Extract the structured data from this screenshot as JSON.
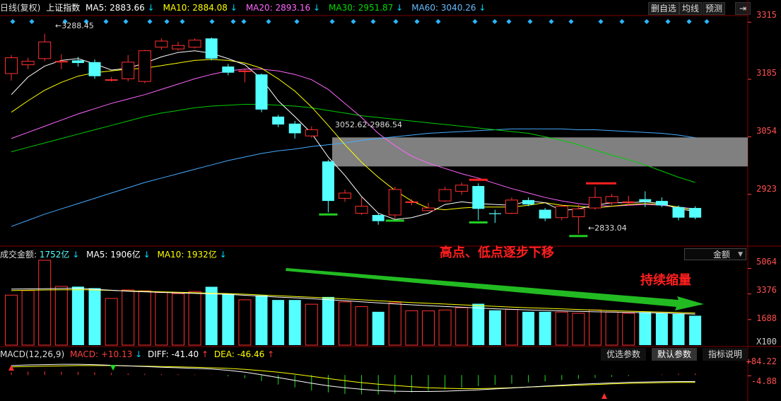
{
  "header": {
    "label": "日线(复权)",
    "name": "上证指数",
    "ma": [
      {
        "label": "MA5:",
        "value": "2883.66",
        "color": "#ffffff"
      },
      {
        "label": "MA10:",
        "value": "2884.08",
        "color": "#ffff00"
      },
      {
        "label": "MA20:",
        "value": "2893.16",
        "color": "#ff66ff"
      },
      {
        "label": "MA30:",
        "value": "2951.87",
        "color": "#00dd00"
      },
      {
        "label": "MA60:",
        "value": "3040.26",
        "color": "#66bbff"
      }
    ],
    "arrow": "↓",
    "buttons": [
      "删自选",
      "均线",
      "预测"
    ],
    "menu_icon": "exit-icon"
  },
  "price_axis": [
    "3315",
    "3185",
    "3054",
    "2923"
  ],
  "volume_header": {
    "label": "成交金额:",
    "value": "1752亿",
    "ma5_label": "MA5:",
    "ma5_value": "1906亿",
    "ma10_label": "MA10:",
    "ma10_value": "1932亿",
    "arrow": "↓",
    "select_value": "金额"
  },
  "volume_axis": [
    "5064",
    "3376",
    "1688",
    "X100"
  ],
  "macd_header": {
    "label": "MACD(12,26,9)",
    "macd_label": "MACD:",
    "macd_value": "+10.13",
    "macd_arrow": "↓",
    "diff_label": "DIFF:",
    "diff_value": "-41.40",
    "diff_arrow": "↑",
    "dea_label": "DEA:",
    "dea_value": "-46.46",
    "dea_arrow": "↑",
    "tabs": [
      "优选参数",
      "默认参数",
      "指标说明"
    ]
  },
  "macd_axis": [
    "+84.22",
    "-4.88"
  ],
  "annotations": {
    "high_label": "3288.45",
    "low_label": "2833.04",
    "box_label": "3052.62-2986.54",
    "text1": "高点、低点逐步下移",
    "text2": "持续缩量"
  },
  "colors": {
    "up": "#ff3030",
    "down": "#54ffff",
    "ma5": "#ffffff",
    "ma10": "#ffff00",
    "ma20": "#ff66ff",
    "ma30": "#00cc00",
    "ma60": "#44aaff",
    "grid": "#800000"
  },
  "chart_data": {
    "type": "candlestick",
    "price_ylim": [
      2810,
      3330
    ],
    "candles": [
      {
        "o": 3198,
        "c": 3234,
        "h": 3240,
        "l": 3182
      },
      {
        "o": 3218,
        "c": 3226,
        "h": 3234,
        "l": 3208
      },
      {
        "o": 3232,
        "c": 3270,
        "h": 3288.45,
        "l": 3226
      },
      {
        "o": 3224,
        "c": 3226,
        "h": 3242,
        "l": 3208
      },
      {
        "o": 3228,
        "c": 3222,
        "h": 3236,
        "l": 3214
      },
      {
        "o": 3224,
        "c": 3192,
        "h": 3230,
        "l": 3186
      },
      {
        "o": 3184,
        "c": 3184,
        "h": 3190,
        "l": 3180
      },
      {
        "o": 3186,
        "c": 3224,
        "h": 3240,
        "l": 3180
      },
      {
        "o": 3180,
        "c": 3250,
        "h": 3252,
        "l": 3176
      },
      {
        "o": 3258,
        "c": 3272,
        "h": 3278,
        "l": 3252
      },
      {
        "o": 3254,
        "c": 3262,
        "h": 3270,
        "l": 3250
      },
      {
        "o": 3258,
        "c": 3274,
        "h": 3278,
        "l": 3255
      },
      {
        "o": 3278,
        "c": 3232,
        "h": 3280,
        "l": 3228
      },
      {
        "o": 3214,
        "c": 3200,
        "h": 3220,
        "l": 3194
      },
      {
        "o": 3204,
        "c": 3204,
        "h": 3210,
        "l": 3178
      },
      {
        "o": 3196,
        "c": 3116,
        "h": 3198,
        "l": 3110
      },
      {
        "o": 3100,
        "c": 3082,
        "h": 3104,
        "l": 3076
      },
      {
        "o": 3084,
        "c": 3062,
        "h": 3090,
        "l": 3050
      },
      {
        "o": 3056,
        "c": 3070,
        "h": 3078,
        "l": 3052
      },
      {
        "o": 2998,
        "c": 2908,
        "h": 3002,
        "l": 2882
      },
      {
        "o": 2914,
        "c": 2926,
        "h": 2934,
        "l": 2906
      },
      {
        "o": 2880,
        "c": 2896,
        "h": 2916,
        "l": 2876
      },
      {
        "o": 2876,
        "c": 2862,
        "h": 2880,
        "l": 2854
      },
      {
        "o": 2876,
        "c": 2934,
        "h": 2940,
        "l": 2868
      },
      {
        "o": 2906,
        "c": 2906,
        "h": 2912,
        "l": 2898
      },
      {
        "o": 2886,
        "c": 2892,
        "h": 2904,
        "l": 2884
      },
      {
        "o": 2908,
        "c": 2934,
        "h": 2940,
        "l": 2906
      },
      {
        "o": 2930,
        "c": 2944,
        "h": 2950,
        "l": 2922
      },
      {
        "o": 2942,
        "c": 2890,
        "h": 2948,
        "l": 2864
      },
      {
        "o": 2880,
        "c": 2878,
        "h": 2888,
        "l": 2858
      },
      {
        "o": 2880,
        "c": 2910,
        "h": 2916,
        "l": 2878
      },
      {
        "o": 2910,
        "c": 2900,
        "h": 2916,
        "l": 2896
      },
      {
        "o": 2888,
        "c": 2868,
        "h": 2892,
        "l": 2862
      },
      {
        "o": 2870,
        "c": 2896,
        "h": 2900,
        "l": 2864
      },
      {
        "o": 2872,
        "c": 2890,
        "h": 2900,
        "l": 2833.04
      },
      {
        "o": 2892,
        "c": 2916,
        "h": 2940,
        "l": 2888
      },
      {
        "o": 2904,
        "c": 2918,
        "h": 2924,
        "l": 2898
      },
      {
        "o": 2906,
        "c": 2906,
        "h": 2920,
        "l": 2898
      },
      {
        "o": 2912,
        "c": 2906,
        "h": 2930,
        "l": 2894
      },
      {
        "o": 2908,
        "c": 2898,
        "h": 2916,
        "l": 2894
      },
      {
        "o": 2894,
        "c": 2870,
        "h": 2898,
        "l": 2864
      },
      {
        "o": 2892,
        "c": 2870,
        "h": 2896,
        "l": 2866
      }
    ],
    "ma5": [
      3150,
      3190,
      3215,
      3228,
      3232,
      3220,
      3206,
      3210,
      3222,
      3236,
      3246,
      3250,
      3244,
      3232,
      3218,
      3186,
      3136,
      3100,
      3062,
      3008,
      2966,
      2918,
      2880,
      2866,
      2870,
      2880,
      2900,
      2906,
      2902,
      2900,
      2898,
      2908,
      2904,
      2886,
      2890,
      2898,
      2904,
      2904,
      2906,
      2902,
      2890,
      2884
    ],
    "ma10": [
      3110,
      3136,
      3160,
      3178,
      3192,
      3200,
      3204,
      3208,
      3210,
      3216,
      3222,
      3228,
      3230,
      3228,
      3222,
      3210,
      3186,
      3158,
      3122,
      3080,
      3036,
      2996,
      2962,
      2932,
      2908,
      2892,
      2888,
      2892,
      2894,
      2894,
      2894,
      2898,
      2904,
      2898,
      2896,
      2892,
      2896,
      2900,
      2902,
      2900,
      2894,
      2886
    ],
    "ma20": [
      3050,
      3064,
      3078,
      3092,
      3106,
      3118,
      3130,
      3140,
      3150,
      3162,
      3174,
      3186,
      3196,
      3204,
      3208,
      3208,
      3204,
      3196,
      3184,
      3162,
      3130,
      3098,
      3062,
      3034,
      3010,
      2994,
      2982,
      2970,
      2960,
      2948,
      2936,
      2926,
      2916,
      2908,
      2902,
      2898,
      2896,
      2898,
      2900,
      2898,
      2894,
      2890
    ],
    "ma30": [
      3020,
      3030,
      3040,
      3050,
      3060,
      3070,
      3080,
      3090,
      3100,
      3108,
      3114,
      3120,
      3124,
      3126,
      3128,
      3128,
      3126,
      3124,
      3120,
      3114,
      3108,
      3102,
      3098,
      3094,
      3090,
      3086,
      3082,
      3078,
      3074,
      3070,
      3066,
      3062,
      3054,
      3046,
      3036,
      3024,
      3012,
      3002,
      2990,
      2976,
      2962,
      2950
    ],
    "ma60": [
      2850,
      2864,
      2878,
      2890,
      2902,
      2914,
      2926,
      2938,
      2950,
      2960,
      2970,
      2980,
      2990,
      3000,
      3008,
      3016,
      3022,
      3026,
      3032,
      3036,
      3040,
      3046,
      3050,
      3054,
      3058,
      3062,
      3064,
      3066,
      3068,
      3070,
      3072,
      3072,
      3072,
      3072,
      3070,
      3070,
      3068,
      3066,
      3064,
      3062,
      3058,
      3052
    ],
    "box_range": [
      2986.54,
      3052.62
    ],
    "volume_ylim": [
      0,
      5600
    ],
    "volume": [
      3300,
      3600,
      5600,
      3880,
      3860,
      3760,
      3080,
      3640,
      3580,
      3470,
      3400,
      3540,
      3850,
      3400,
      2990,
      3280,
      2980,
      2980,
      2700,
      3180,
      2850,
      2540,
      2200,
      2800,
      2270,
      2260,
      2320,
      2470,
      2730,
      2300,
      2350,
      2200,
      2200,
      2180,
      2100,
      2320,
      2180,
      2100,
      2180,
      2120,
      2060,
      1940
    ],
    "volume_ma5": [
      3700,
      3710,
      3720,
      3740,
      3760,
      3680,
      3620,
      3560,
      3520,
      3480,
      3440,
      3410,
      3380,
      3350,
      3290,
      3230,
      3170,
      3120,
      3060,
      3000,
      2930,
      2860,
      2790,
      2720,
      2660,
      2600,
      2550,
      2500,
      2450,
      2400,
      2360,
      2320,
      2290,
      2260,
      2230,
      2200,
      2180,
      2160,
      2140,
      2120,
      2080,
      2040
    ],
    "volume_ma10": [
      3600,
      3620,
      3640,
      3650,
      3660,
      3640,
      3610,
      3580,
      3550,
      3520,
      3490,
      3460,
      3430,
      3400,
      3360,
      3310,
      3260,
      3210,
      3160,
      3110,
      3050,
      2990,
      2930,
      2870,
      2810,
      2760,
      2710,
      2660,
      2610,
      2560,
      2510,
      2470,
      2430,
      2390,
      2350,
      2310,
      2270,
      2240,
      2210,
      2180,
      2150,
      2120
    ],
    "macd_ylim": [
      -160,
      100
    ],
    "macd": [
      18,
      22,
      24,
      22,
      20,
      18,
      14,
      10,
      8,
      6,
      6,
      4,
      2,
      -8,
      -20,
      -38,
      -60,
      -78,
      -98,
      -110,
      -120,
      -122,
      -124,
      -118,
      -110,
      -100,
      -90,
      -80,
      -70,
      -62,
      -54,
      -46,
      -40,
      -32,
      -24,
      -18,
      -12,
      -6,
      0,
      4,
      8,
      10.13
    ],
    "diff": [
      60,
      64,
      66,
      68,
      68,
      66,
      62,
      58,
      54,
      50,
      46,
      42,
      38,
      30,
      18,
      2,
      -16,
      -34,
      -52,
      -68,
      -80,
      -90,
      -98,
      -102,
      -104,
      -104,
      -102,
      -98,
      -94,
      -88,
      -82,
      -76,
      -70,
      -64,
      -58,
      -54,
      -50,
      -46,
      -44,
      -42,
      -41.4,
      -41.4
    ],
    "dea": [
      52,
      54,
      56,
      58,
      60,
      60,
      60,
      58,
      56,
      54,
      52,
      50,
      46,
      42,
      36,
      28,
      18,
      6,
      -8,
      -22,
      -36,
      -48,
      -58,
      -66,
      -74,
      -80,
      -84,
      -86,
      -86,
      -84,
      -80,
      -76,
      -72,
      -68,
      -64,
      -60,
      -56,
      -53,
      -50,
      -48,
      -46.46,
      -46.46
    ]
  }
}
